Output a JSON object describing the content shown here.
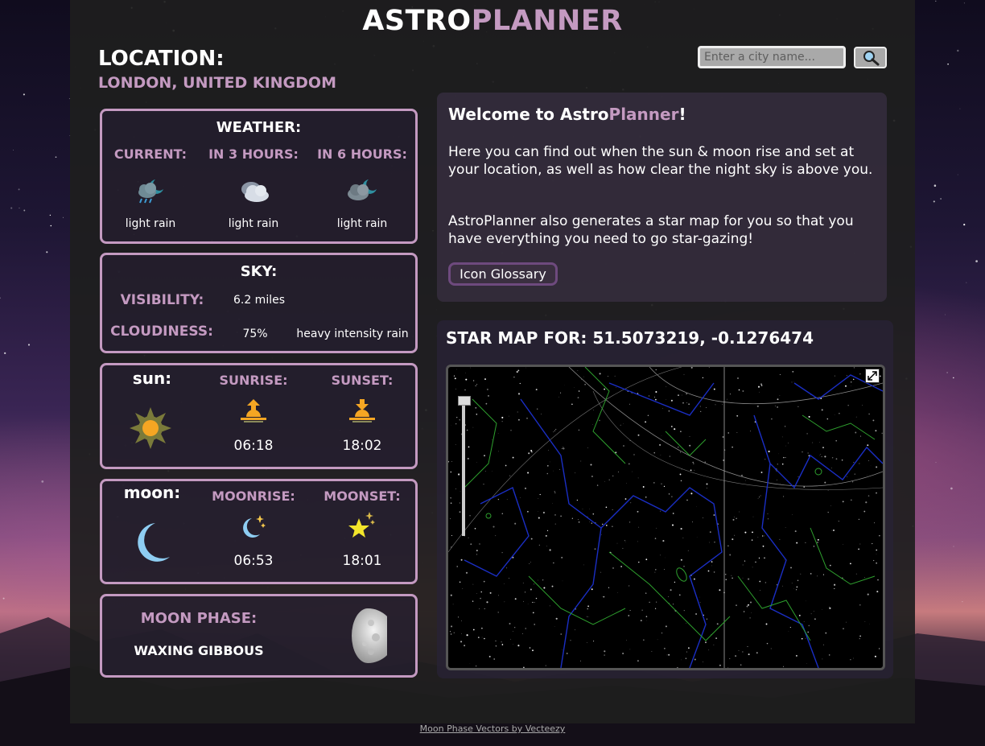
{
  "app": {
    "title_a": "ASTRO",
    "title_b": "PLANNER"
  },
  "location": {
    "heading": "LOCATION:",
    "value": "LONDON, UNITED KINGDOM"
  },
  "search": {
    "placeholder": "Enter a city name...",
    "button_icon": "search-icon"
  },
  "weather": {
    "heading": "WEATHER:",
    "columns": [
      {
        "label": "CURRENT:",
        "icon": "night-rain-cloud-icon",
        "desc": "light rain"
      },
      {
        "label": "IN 3 HOURS:",
        "icon": "cloud-icon",
        "desc": "light rain"
      },
      {
        "label": "IN 6 HOURS:",
        "icon": "night-cloud-icon",
        "desc": "light rain"
      }
    ]
  },
  "sky": {
    "heading": "SKY:",
    "visibility_label": "VISIBILITY:",
    "visibility_value": "6.2 miles",
    "cloudiness_label": "CLOUDINESS:",
    "cloudiness_value": "75%",
    "description": "heavy intensity rain"
  },
  "sun": {
    "heading": "sun:",
    "sunrise_label": "SUNRISE:",
    "sunrise_time": "06:18",
    "sunset_label": "SUNSET:",
    "sunset_time": "18:02"
  },
  "moon": {
    "heading": "moon:",
    "moonrise_label": "MOONRISE:",
    "moonrise_time": "06:53",
    "moonset_label": "MOONSET:",
    "moonset_time": "18:01"
  },
  "moon_phase": {
    "label": "MOON PHASE:",
    "value": "WAXING GIBBOUS"
  },
  "welcome": {
    "title_a": "Welcome to Astro",
    "title_b": "Planner",
    "title_c": "!",
    "p1": "Here you can find out when the sun & moon rise and set at your location, as well as how clear the night sky is above you.",
    "p2": "AstroPlanner also generates a star map for you so that you have everything you need to go star-gazing!",
    "glossary_button": "Icon Glossary"
  },
  "starmap": {
    "title": "STAR MAP FOR: 51.5073219, -0.1276474"
  },
  "footer": {
    "text": "Moon Phase Vectors by Vecteezy"
  },
  "colors": {
    "accent": "#c49ac1",
    "panel": "#1e1e1e"
  }
}
